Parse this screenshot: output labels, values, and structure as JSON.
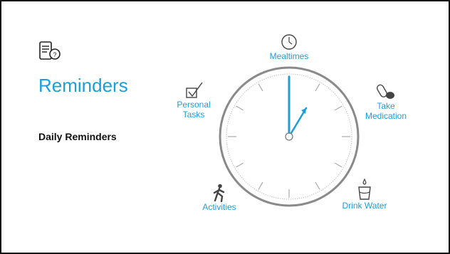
{
  "slide": {
    "title": "Reminders",
    "subtitle": "Daily Reminders",
    "accent_color": "#1a9fd9",
    "app_icon": "phone-help-icon"
  },
  "categories": [
    {
      "label": "Mealtimes",
      "icon": "clock-icon"
    },
    {
      "label": "Take Medication",
      "line1": "Take",
      "line2": "Medication",
      "icon": "pills-icon"
    },
    {
      "label": "Drink Water",
      "icon": "water-glass-icon"
    },
    {
      "label": "Activities",
      "icon": "walking-person-icon"
    },
    {
      "label": "Personal Tasks",
      "line1": "Personal",
      "line2": "Tasks",
      "icon": "checkbox-icon"
    }
  ],
  "clock": {
    "hour_hand_points_to": 1,
    "minute_hand_points_to": 12
  }
}
